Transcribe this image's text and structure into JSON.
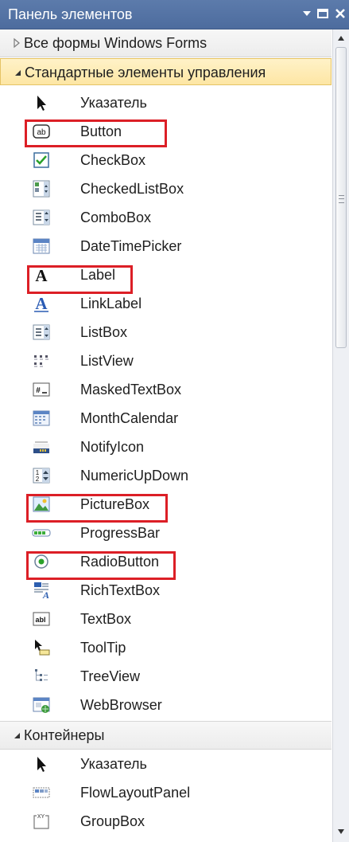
{
  "window": {
    "title": "Панель элементов"
  },
  "groups": {
    "all_forms": {
      "label": "Все формы Windows Forms"
    },
    "standard": {
      "label": "Стандартные элементы управления",
      "items": [
        {
          "label": "Указатель",
          "icon": "pointer-icon"
        },
        {
          "label": "Button",
          "icon": "button-icon"
        },
        {
          "label": "CheckBox",
          "icon": "checkbox-icon"
        },
        {
          "label": "CheckedListBox",
          "icon": "checkedlistbox-icon"
        },
        {
          "label": "ComboBox",
          "icon": "combobox-icon"
        },
        {
          "label": "DateTimePicker",
          "icon": "datetimepicker-icon"
        },
        {
          "label": "Label",
          "icon": "label-icon"
        },
        {
          "label": "LinkLabel",
          "icon": "linklabel-icon"
        },
        {
          "label": "ListBox",
          "icon": "listbox-icon"
        },
        {
          "label": "ListView",
          "icon": "listview-icon"
        },
        {
          "label": "MaskedTextBox",
          "icon": "maskedtextbox-icon"
        },
        {
          "label": "MonthCalendar",
          "icon": "monthcalendar-icon"
        },
        {
          "label": "NotifyIcon",
          "icon": "notifyicon-icon"
        },
        {
          "label": "NumericUpDown",
          "icon": "numericupdown-icon"
        },
        {
          "label": "PictureBox",
          "icon": "picturebox-icon"
        },
        {
          "label": "ProgressBar",
          "icon": "progressbar-icon"
        },
        {
          "label": "RadioButton",
          "icon": "radiobutton-icon"
        },
        {
          "label": "RichTextBox",
          "icon": "richtextbox-icon"
        },
        {
          "label": "TextBox",
          "icon": "textbox-icon"
        },
        {
          "label": "ToolTip",
          "icon": "tooltip-icon"
        },
        {
          "label": "TreeView",
          "icon": "treeview-icon"
        },
        {
          "label": "WebBrowser",
          "icon": "webbrowser-icon"
        }
      ]
    },
    "containers": {
      "label": "Контейнеры",
      "items": [
        {
          "label": "Указатель",
          "icon": "pointer-icon"
        },
        {
          "label": "FlowLayoutPanel",
          "icon": "flowlayoutpanel-icon"
        },
        {
          "label": "GroupBox",
          "icon": "groupbox-icon"
        }
      ]
    }
  },
  "highlighted_items": [
    "Button",
    "Label",
    "PictureBox",
    "RadioButton"
  ],
  "colors": {
    "highlight_border": "#dc1f26",
    "titlebar": "#4d6c9e",
    "selected_group": "#fde6a4"
  }
}
